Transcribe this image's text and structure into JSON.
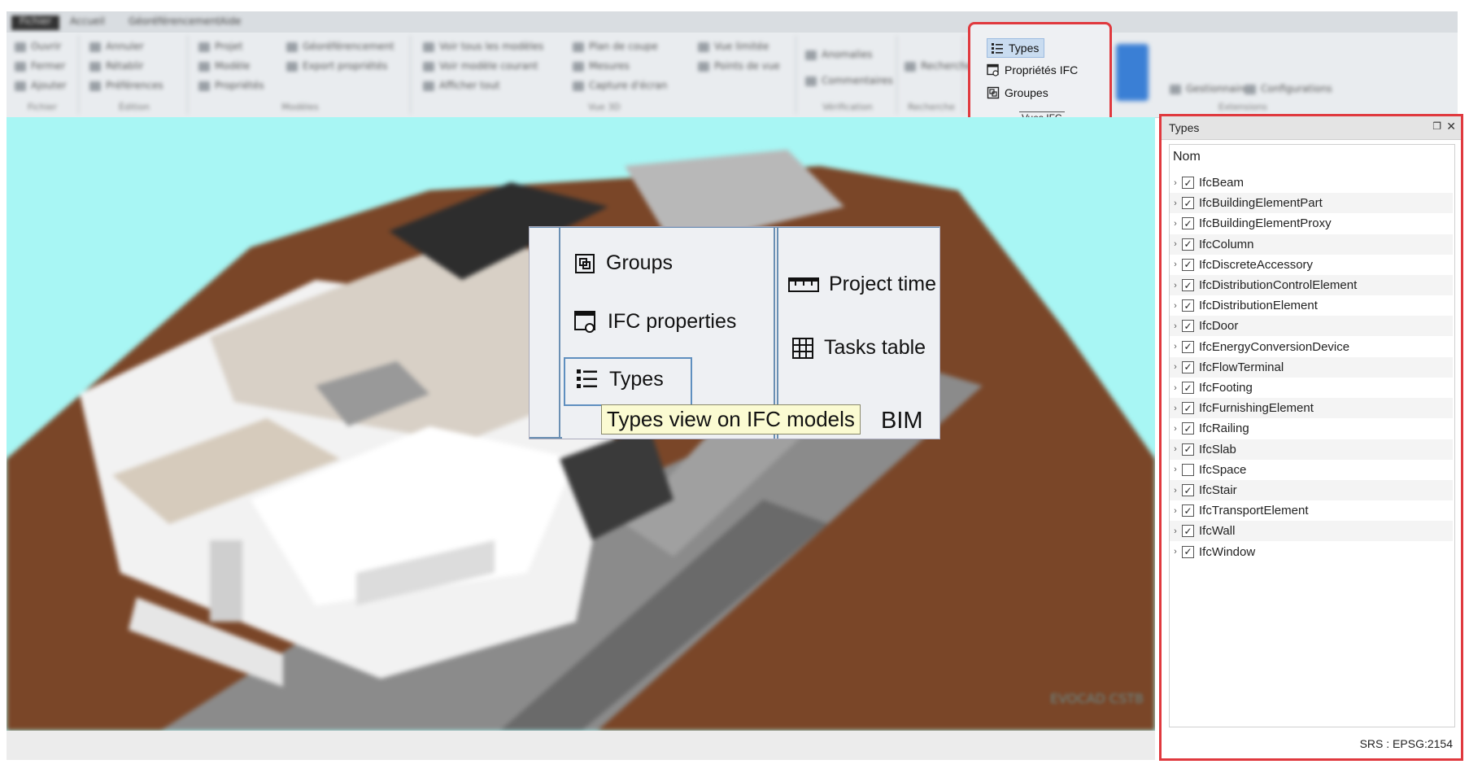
{
  "ribbon": {
    "tabs": [
      "Fichier",
      "Accueil",
      "Géoréférencement",
      "Aide"
    ],
    "groups": [
      {
        "title": "Fichier",
        "items": [
          "Ouvrir",
          "Fermer",
          "Ajouter"
        ]
      },
      {
        "title": "Édition",
        "items": [
          "Annuler",
          "Rétablir",
          "Préférences"
        ]
      },
      {
        "title": "Modèles",
        "items": [
          "Projet",
          "Modèle",
          "Propriétés",
          "Géoréférencement",
          "Export propriétés"
        ]
      },
      {
        "title": "Vue 3D",
        "items": [
          "Voir tous les modèles",
          "Voir modèle courant",
          "Afficher tout",
          "Plan de coupe",
          "Mesures",
          "Capture d'écran",
          "Vue limitée",
          "Points de vue"
        ]
      },
      {
        "title": "Vérification",
        "items": [
          "Anomalies",
          "Commentaires"
        ]
      },
      {
        "title": "Recherche",
        "items": [
          "Recherche"
        ]
      },
      {
        "title": "Extensions",
        "items": [
          "Gestionnaire",
          "Configurations"
        ]
      }
    ]
  },
  "vues_ifc": {
    "title": "Vues IFC",
    "types": "Types",
    "proprietes": "Propriétés IFC",
    "groupes": "Groupes"
  },
  "zoom": {
    "groups": "Groups",
    "ifc_properties": "IFC properties",
    "types": "Types",
    "project_time": "Project time",
    "tasks_table": "Tasks table",
    "tooltip": "Types view on IFC models",
    "bim_fragment": "BIM"
  },
  "types_panel": {
    "title": "Types",
    "column": "Nom",
    "status": "SRS : EPSG:2154",
    "items": [
      {
        "label": "IfcBeam",
        "checked": true
      },
      {
        "label": "IfcBuildingElementPart",
        "checked": true
      },
      {
        "label": "IfcBuildingElementProxy",
        "checked": true
      },
      {
        "label": "IfcColumn",
        "checked": true
      },
      {
        "label": "IfcDiscreteAccessory",
        "checked": true
      },
      {
        "label": "IfcDistributionControlElement",
        "checked": true
      },
      {
        "label": "IfcDistributionElement",
        "checked": true
      },
      {
        "label": "IfcDoor",
        "checked": true
      },
      {
        "label": "IfcEnergyConversionDevice",
        "checked": true
      },
      {
        "label": "IfcFlowTerminal",
        "checked": true
      },
      {
        "label": "IfcFooting",
        "checked": true
      },
      {
        "label": "IfcFurnishingElement",
        "checked": true
      },
      {
        "label": "IfcRailing",
        "checked": true
      },
      {
        "label": "IfcSlab",
        "checked": true
      },
      {
        "label": "IfcSpace",
        "checked": false
      },
      {
        "label": "IfcStair",
        "checked": true
      },
      {
        "label": "IfcTransportElement",
        "checked": true
      },
      {
        "label": "IfcWall",
        "checked": true
      },
      {
        "label": "IfcWindow",
        "checked": true
      }
    ]
  },
  "viewport": {
    "watermark": "EVOCAD CSTB"
  }
}
